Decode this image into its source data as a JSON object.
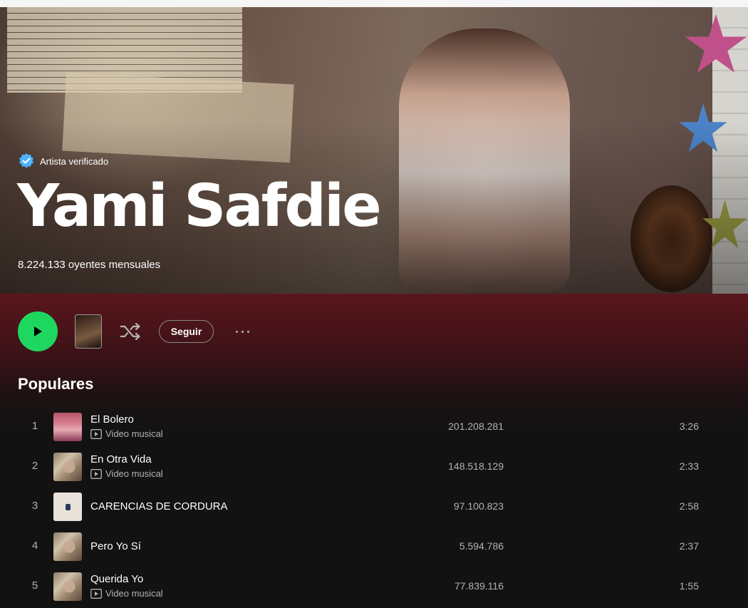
{
  "artist": {
    "verified_label": "Artista verificado",
    "name": "Yami Safdie",
    "monthly_listeners": "8.224.133 oyentes mensuales"
  },
  "actions": {
    "follow_label": "Seguir"
  },
  "popular": {
    "title": "Populares",
    "tracks": [
      {
        "number": "1",
        "title": "El Bolero",
        "subtitle": "Video musical",
        "plays": "201.208.281",
        "duration": "3:26"
      },
      {
        "number": "2",
        "title": "En Otra Vida",
        "subtitle": "Video musical",
        "plays": "148.518.129",
        "duration": "2:33"
      },
      {
        "number": "3",
        "title": "CARENCIAS DE CORDURA",
        "subtitle": "",
        "plays": "97.100.823",
        "duration": "2:58"
      },
      {
        "number": "4",
        "title": "Pero Yo Sí",
        "subtitle": "",
        "plays": "5.594.786",
        "duration": "2:37"
      },
      {
        "number": "5",
        "title": "Querida Yo",
        "subtitle": "Video musical",
        "plays": "77.839.116",
        "duration": "1:55"
      }
    ]
  },
  "colors": {
    "accent": "#1ed760",
    "verified_badge": "#4cb3ff",
    "background": "#121212",
    "header_tint": "#5a161c"
  },
  "icons": {
    "verified": "verified-badge-icon",
    "play": "play-icon",
    "shuffle": "shuffle-icon",
    "more": "more-options-icon",
    "video": "video-icon"
  }
}
